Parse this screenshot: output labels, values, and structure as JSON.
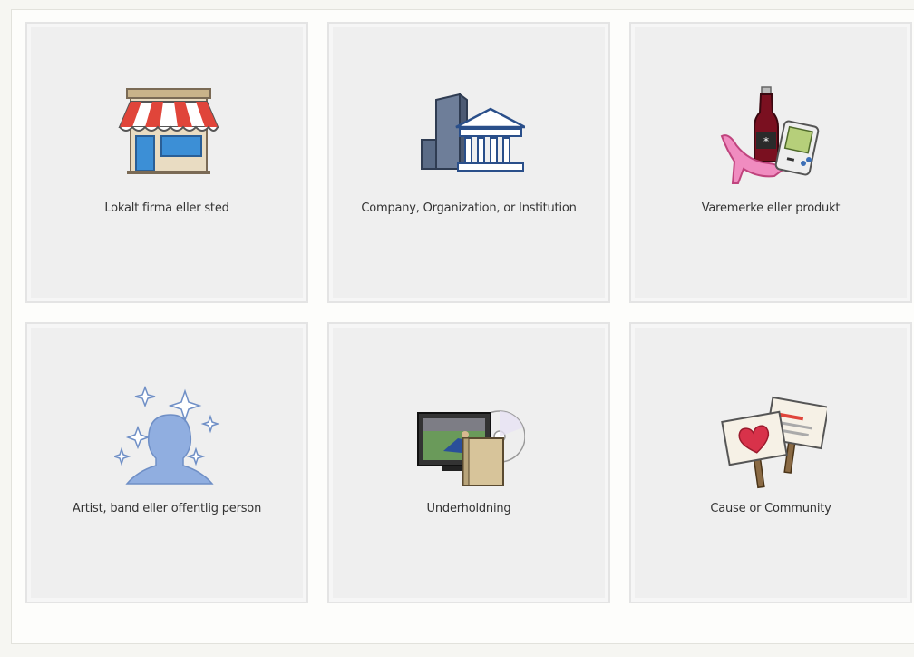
{
  "categories": [
    {
      "label": "Lokalt firma eller sted",
      "icon": "storefront-icon"
    },
    {
      "label": "Company, Organization, or Institution",
      "icon": "building-icon"
    },
    {
      "label": "Varemerke eller produkt",
      "icon": "products-icon"
    },
    {
      "label": "Artist, band eller offentlig person",
      "icon": "person-silhouette-icon"
    },
    {
      "label": "Underholdning",
      "icon": "entertainment-icon"
    },
    {
      "label": "Cause or Community",
      "icon": "protest-signs-icon"
    }
  ],
  "colors": {
    "card_background": "#efefef",
    "card_border": "#e4e4e4",
    "text": "#333333",
    "accent_blue": "#5b84c4",
    "accent_red": "#e0453a"
  }
}
